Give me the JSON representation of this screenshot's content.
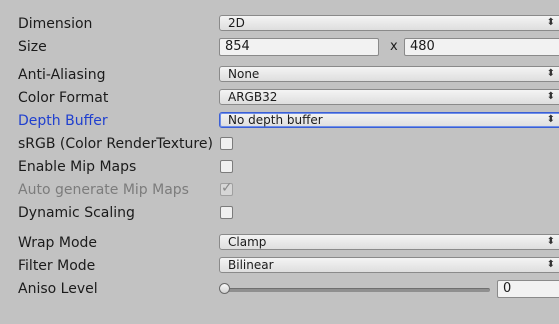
{
  "dimension": {
    "label": "Dimension",
    "value": "2D"
  },
  "size": {
    "label": "Size",
    "width": "854",
    "x": "x",
    "height": "480"
  },
  "anti_aliasing": {
    "label": "Anti-Aliasing",
    "value": "None"
  },
  "color_format": {
    "label": "Color Format",
    "value": "ARGB32"
  },
  "depth_buffer": {
    "label": "Depth Buffer",
    "value": "No depth buffer"
  },
  "srgb": {
    "label": "sRGB (Color RenderTexture)",
    "checked": false
  },
  "enable_mip_maps": {
    "label": "Enable Mip Maps",
    "checked": false
  },
  "auto_generate_mip_maps": {
    "label": "Auto generate Mip Maps",
    "checked": true,
    "disabled": true
  },
  "dynamic_scaling": {
    "label": "Dynamic Scaling",
    "checked": false
  },
  "wrap_mode": {
    "label": "Wrap Mode",
    "value": "Clamp"
  },
  "filter_mode": {
    "label": "Filter Mode",
    "value": "Bilinear"
  },
  "aniso_level": {
    "label": "Aniso Level",
    "value": "0",
    "level_fraction": 0
  },
  "icons": {
    "dropdown_arrow": "chevron-updown-icon",
    "checkmark": "checkmark-icon"
  },
  "colors": {
    "background": "#c2c2c2",
    "focus_label": "#1f3fcf",
    "disabled_label": "#7c7c7c"
  }
}
